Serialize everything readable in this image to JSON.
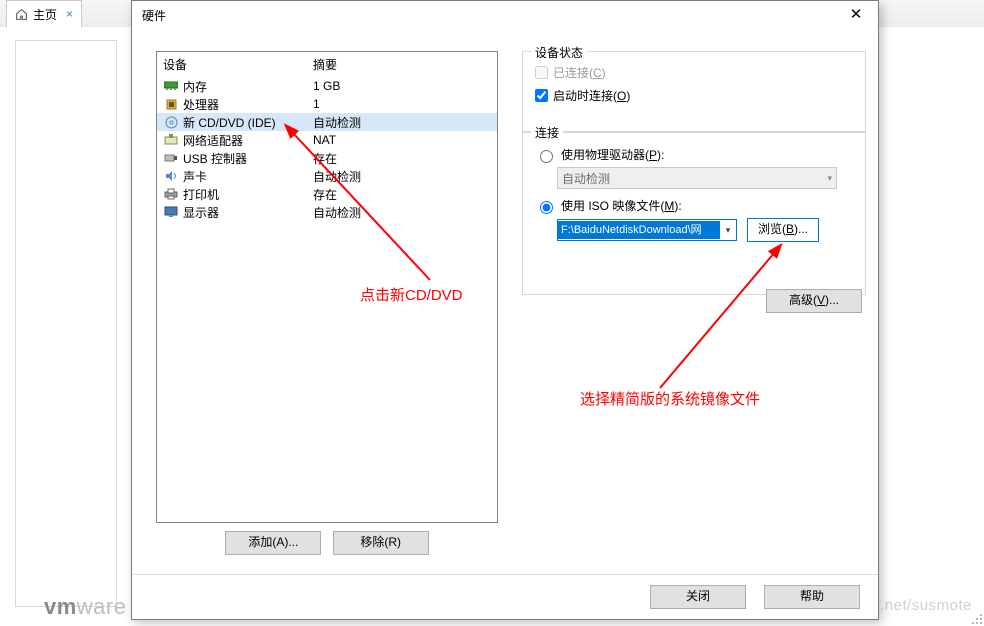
{
  "back": {
    "tab_label": "主页",
    "vmware1": "vm",
    "vmware2": "ware",
    "watermark": "https://blog.csdn.net/susmote"
  },
  "dialog": {
    "title": "硬件",
    "close_glyph": "✕",
    "dev_header": "设备",
    "sum_header": "摘要",
    "devices": [
      {
        "icon": "ram",
        "name": "内存",
        "summary": "1 GB"
      },
      {
        "icon": "cpu",
        "name": "处理器",
        "summary": "1"
      },
      {
        "icon": "cd",
        "name": "新 CD/DVD (IDE)",
        "summary": "自动检测",
        "selected": true
      },
      {
        "icon": "net",
        "name": "网络适配器",
        "summary": "NAT"
      },
      {
        "icon": "usb",
        "name": "USB 控制器",
        "summary": "存在"
      },
      {
        "icon": "snd",
        "name": "声卡",
        "summary": "自动检测"
      },
      {
        "icon": "prn",
        "name": "打印机",
        "summary": "存在"
      },
      {
        "icon": "mon",
        "name": "显示器",
        "summary": "自动检测"
      }
    ],
    "add_btn": "添加(A)...",
    "remove_btn": "移除(R)",
    "status": {
      "legend": "设备状态",
      "connected_label": "已连接(C)",
      "connected_checked": false,
      "connected_disabled": true,
      "onstart_label": "启动时连接(O)",
      "onstart_checked": true
    },
    "conn": {
      "legend": "连接",
      "phys_label": "使用物理驱动器(P):",
      "phys_value": "自动检测",
      "iso_label": "使用 ISO 映像文件(M):",
      "iso_value": "F:\\BaiduNetdiskDownload\\网",
      "browse_btn": "浏览(B)...",
      "selected": "iso"
    },
    "advanced_btn": "高级(V)...",
    "close_btn": "关闭",
    "help_btn": "帮助"
  },
  "annotations": {
    "left_text": "点击新CD/DVD",
    "right_text": "选择精简版的系统镜像文件"
  }
}
